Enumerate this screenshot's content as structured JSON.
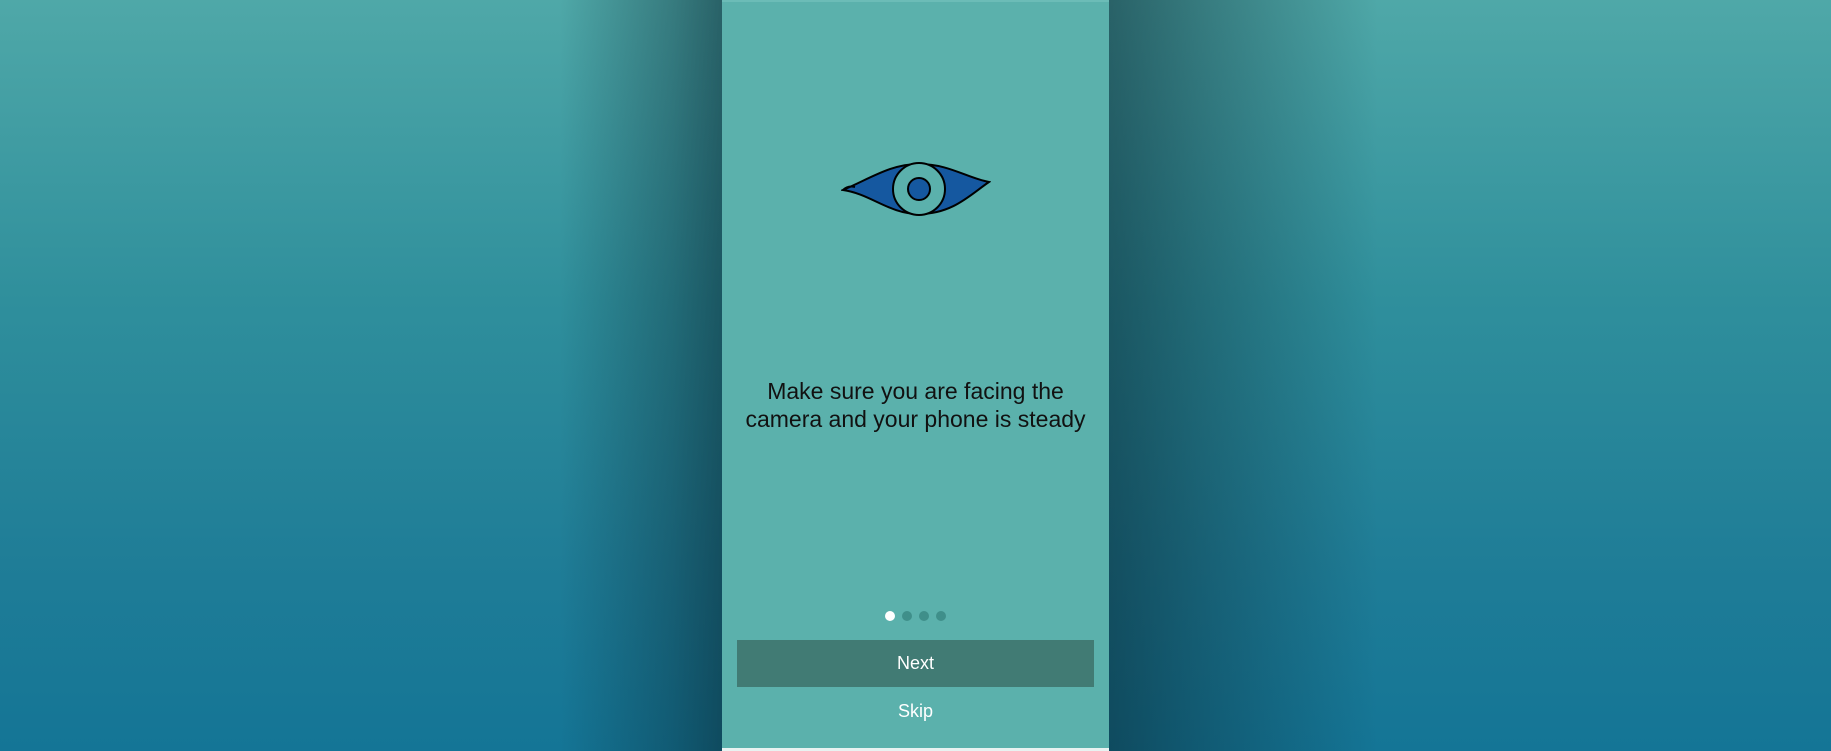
{
  "onboarding": {
    "message": "Make sure you are facing the camera and your phone is steady",
    "illustration_icon": "eye-icon",
    "pagination": {
      "total": 4,
      "current": 1
    },
    "next_label": "Next",
    "skip_label": "Skip"
  },
  "colors": {
    "screen_background": "#5bb1ac",
    "eye_fill": "#1558a0",
    "next_button": "#417b74",
    "active_dot": "#ffffff",
    "inactive_dot": "#3f8f8a"
  }
}
